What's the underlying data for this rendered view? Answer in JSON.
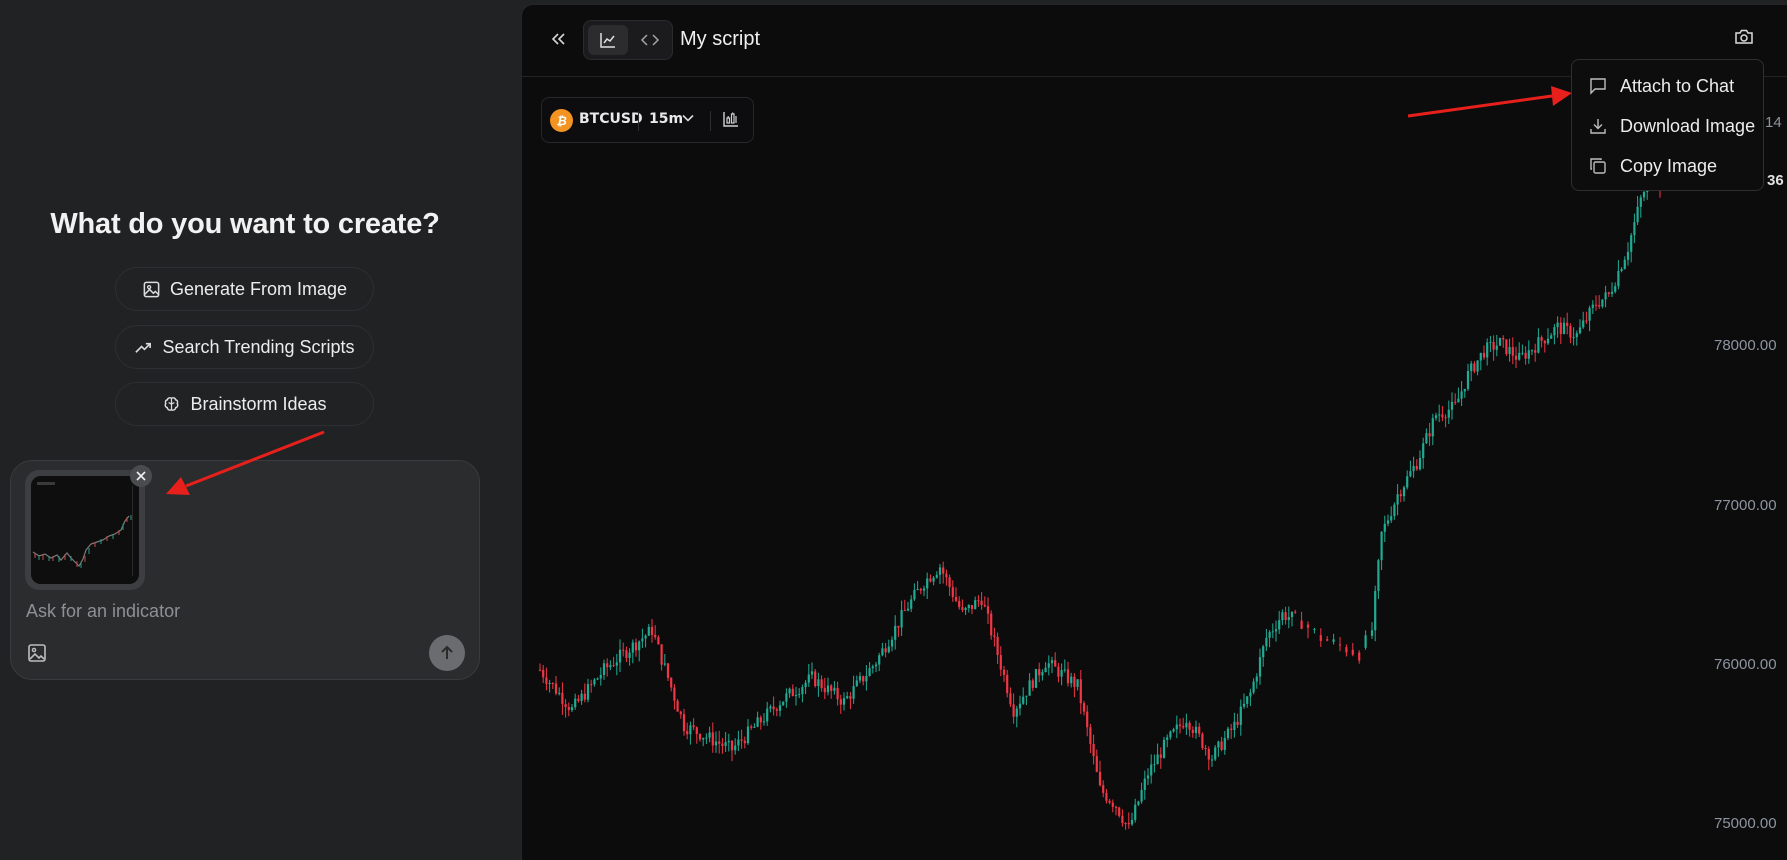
{
  "left_panel": {
    "heading": "What do you want to create?",
    "actions": [
      {
        "label": "Generate From Image",
        "icon": "image-icon"
      },
      {
        "label": "Search Trending Scripts",
        "icon": "trending-up-icon"
      },
      {
        "label": "Brainstorm Ideas",
        "icon": "brain-icon"
      }
    ],
    "composer": {
      "placeholder": "Ask for an indicator",
      "attachment": "chart-thumbnail",
      "remove_icon": "close-icon",
      "image_button_icon": "image-icon",
      "send_button_icon": "arrow-up-icon"
    }
  },
  "chart_panel": {
    "title": "My script",
    "collapse_icon": "double-chevron-left-icon",
    "view_toggle": [
      {
        "icon": "chart-icon",
        "active": true
      },
      {
        "icon": "code-icon",
        "active": false
      }
    ],
    "camera_icon": "camera-icon",
    "symbol": "BTCUSD",
    "symbol_icon": "bitcoin-icon",
    "symbol_icon_glyph": "₿",
    "timeframe": "15m",
    "indicator_icon": "indicators-icon",
    "price_axis": [
      "78000.00",
      "77000.00",
      "76000.00",
      "75000.00"
    ],
    "clipped_axis_labels": [
      "14",
      "36"
    ]
  },
  "snapshot_menu": {
    "items": [
      {
        "label": "Attach to Chat",
        "icon": "chat-icon"
      },
      {
        "label": "Download Image",
        "icon": "download-icon"
      },
      {
        "label": "Copy Image",
        "icon": "copy-icon"
      }
    ]
  },
  "colors": {
    "up": "#22ab94",
    "down": "#f23645",
    "annotation_arrow": "#e8201c",
    "bitcoin": "#f39321"
  },
  "chart_data": {
    "type": "candlestick",
    "symbol": "BTCUSD",
    "interval": "15m",
    "ylim": [
      74800,
      79400
    ],
    "y_ticks": [
      75000,
      76000,
      77000,
      78000
    ],
    "close_path": [
      [
        0,
        75950
      ],
      [
        10,
        75700
      ],
      [
        20,
        75950
      ],
      [
        35,
        76200
      ],
      [
        45,
        75600
      ],
      [
        60,
        75450
      ],
      [
        75,
        75750
      ],
      [
        85,
        75900
      ],
      [
        95,
        75750
      ],
      [
        105,
        76000
      ],
      [
        115,
        76350
      ],
      [
        120,
        76500
      ],
      [
        125,
        76600
      ],
      [
        132,
        76300
      ],
      [
        138,
        76400
      ],
      [
        148,
        75700
      ],
      [
        158,
        76000
      ],
      [
        168,
        75850
      ],
      [
        175,
        75200
      ],
      [
        180,
        75100
      ],
      [
        184,
        74950
      ],
      [
        190,
        75300
      ],
      [
        196,
        75500
      ],
      [
        202,
        75650
      ],
      [
        210,
        75400
      ],
      [
        217,
        75600
      ],
      [
        222,
        75800
      ],
      [
        227,
        76150
      ],
      [
        232,
        76300
      ],
      [
        238,
        76250
      ],
      [
        244,
        76150
      ],
      [
        250,
        76100
      ],
      [
        256,
        76050
      ],
      [
        260,
        76200
      ],
      [
        263,
        76800
      ],
      [
        268,
        77050
      ],
      [
        274,
        77250
      ],
      [
        280,
        77550
      ],
      [
        286,
        77600
      ],
      [
        290,
        77800
      ],
      [
        295,
        77950
      ],
      [
        300,
        78000
      ],
      [
        306,
        77900
      ],
      [
        312,
        78000
      ],
      [
        318,
        78100
      ],
      [
        324,
        78050
      ],
      [
        330,
        78250
      ],
      [
        334,
        78300
      ],
      [
        340,
        78600
      ],
      [
        344,
        78900
      ],
      [
        347,
        79050
      ],
      [
        350,
        79000
      ]
    ]
  }
}
